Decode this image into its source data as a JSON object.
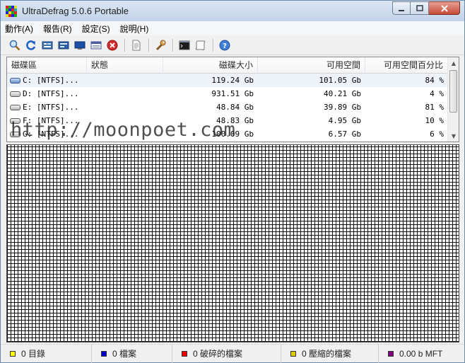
{
  "window": {
    "title": "UltraDefrag 5.0.6 Portable"
  },
  "colors": {
    "title_bg": "#c2d4ea",
    "close_red": "#c74a37",
    "cluster_grid": "#111111"
  },
  "menu": [
    "動作(A)",
    "報告(R)",
    "設定(S)",
    "說明(H)"
  ],
  "toolbar_icons": [
    "magnifier-icon",
    "refresh-icon",
    "defrag-icon",
    "quick-optimize-icon",
    "full-optimize-icon",
    "mft-optimize-icon",
    "stop-icon",
    "report-icon",
    "settings-wrench-icon",
    "console-icon",
    "script-icon",
    "help-icon"
  ],
  "drive_list": {
    "columns": [
      "磁碟區",
      "狀態",
      "磁碟大小",
      "可用空間",
      "可用空間百分比"
    ],
    "rows": [
      {
        "drive": "C: [NTFS]...",
        "status": "",
        "size": "119.24 Gb",
        "free": "101.05 Gb",
        "percent": "84 %"
      },
      {
        "drive": "D: [NTFS]...",
        "status": "",
        "size": "931.51 Gb",
        "free": "40.21 Gb",
        "percent": "4 %"
      },
      {
        "drive": "E: [NTFS]...",
        "status": "",
        "size": "48.84 Gb",
        "free": "39.89 Gb",
        "percent": "81 %"
      },
      {
        "drive": "F: [NTFS]...",
        "status": "",
        "size": "48.83 Gb",
        "free": "4.95 Gb",
        "percent": "10 %"
      },
      {
        "drive": "G: [NTFS]...",
        "status": "",
        "size": "100.09 Gb",
        "free": "6.57 Gb",
        "percent": "6 %"
      }
    ]
  },
  "watermark": "http://moonpoet.com",
  "status": [
    {
      "label": "0 目錄",
      "color": "#ffff00"
    },
    {
      "label": "0 檔案",
      "color": "#0000cc"
    },
    {
      "label": "0 破碎的檔案",
      "color": "#ee0000"
    },
    {
      "label": "0 壓縮的檔案",
      "color": "#ddcc00"
    },
    {
      "label": "0.00 b MFT",
      "color": "#800080"
    }
  ]
}
